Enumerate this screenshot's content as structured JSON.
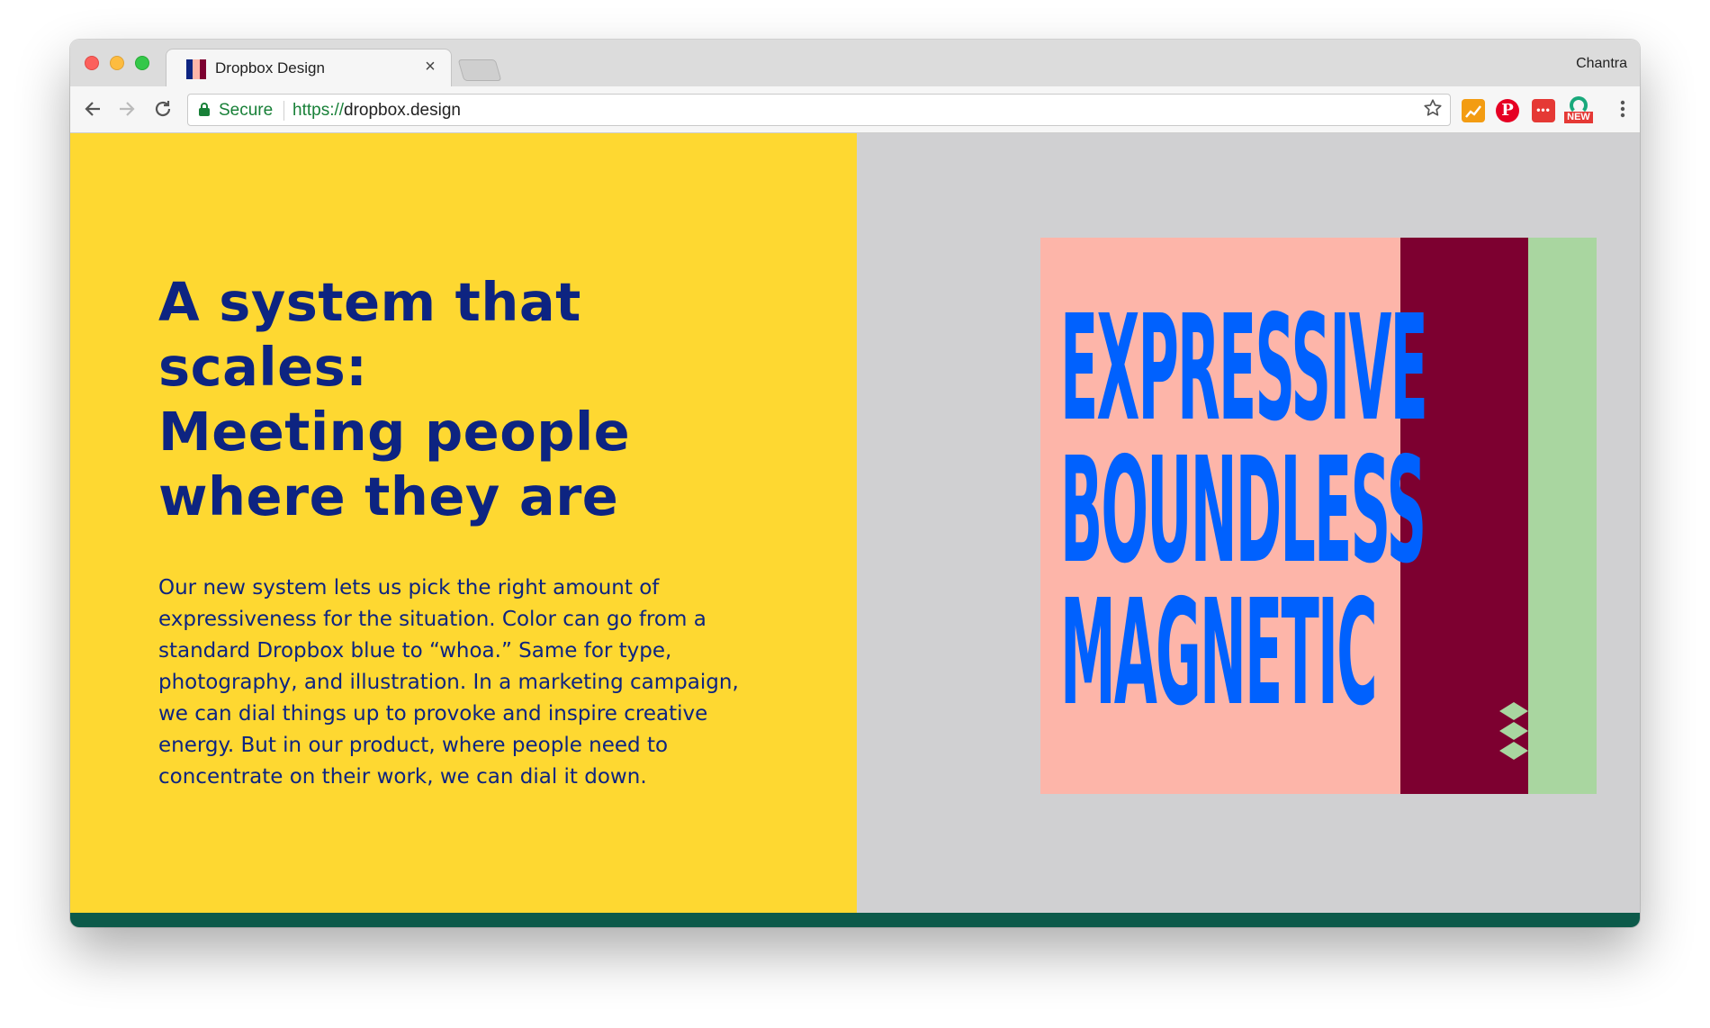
{
  "browser": {
    "tab_title": "Dropbox Design",
    "tab_close": "×",
    "profile_name": "Chantra",
    "secure_label": "Secure",
    "url_scheme": "https://",
    "url_host": "dropbox.design",
    "ext_new_badge": "NEW"
  },
  "hero": {
    "headline_line1": "A system that scales:",
    "headline_line2": "Meeting people where they are",
    "body": "Our new system lets us pick the right amount of expressiveness for the situation. Color can go from a standard Dropbox blue to “whoa.” Same for type, photography, and illustration. In a marketing campaign, we can dial things up to provoke and inspire creative energy. But in our product, where people need to concentrate on their work, we can dial it down."
  },
  "poster": {
    "words": [
      "EXPRESSIVE",
      "BOUNDLESS",
      "MAGNETIC"
    ]
  },
  "colors": {
    "left_panel": "#fed831",
    "right_panel": "#d0d0d2",
    "headline_text": "#0d2481",
    "poster_pink": "#fdb5a9",
    "poster_maroon": "#7d0030",
    "poster_green": "#a9d6a0",
    "poster_text": "#0061fe",
    "footer_bar": "#0c5a4a"
  },
  "icons": [
    "back-arrow-icon",
    "forward-arrow-icon",
    "reload-icon",
    "lock-icon",
    "star-icon",
    "menu-kebab-icon",
    "dropbox-logo-icon"
  ]
}
